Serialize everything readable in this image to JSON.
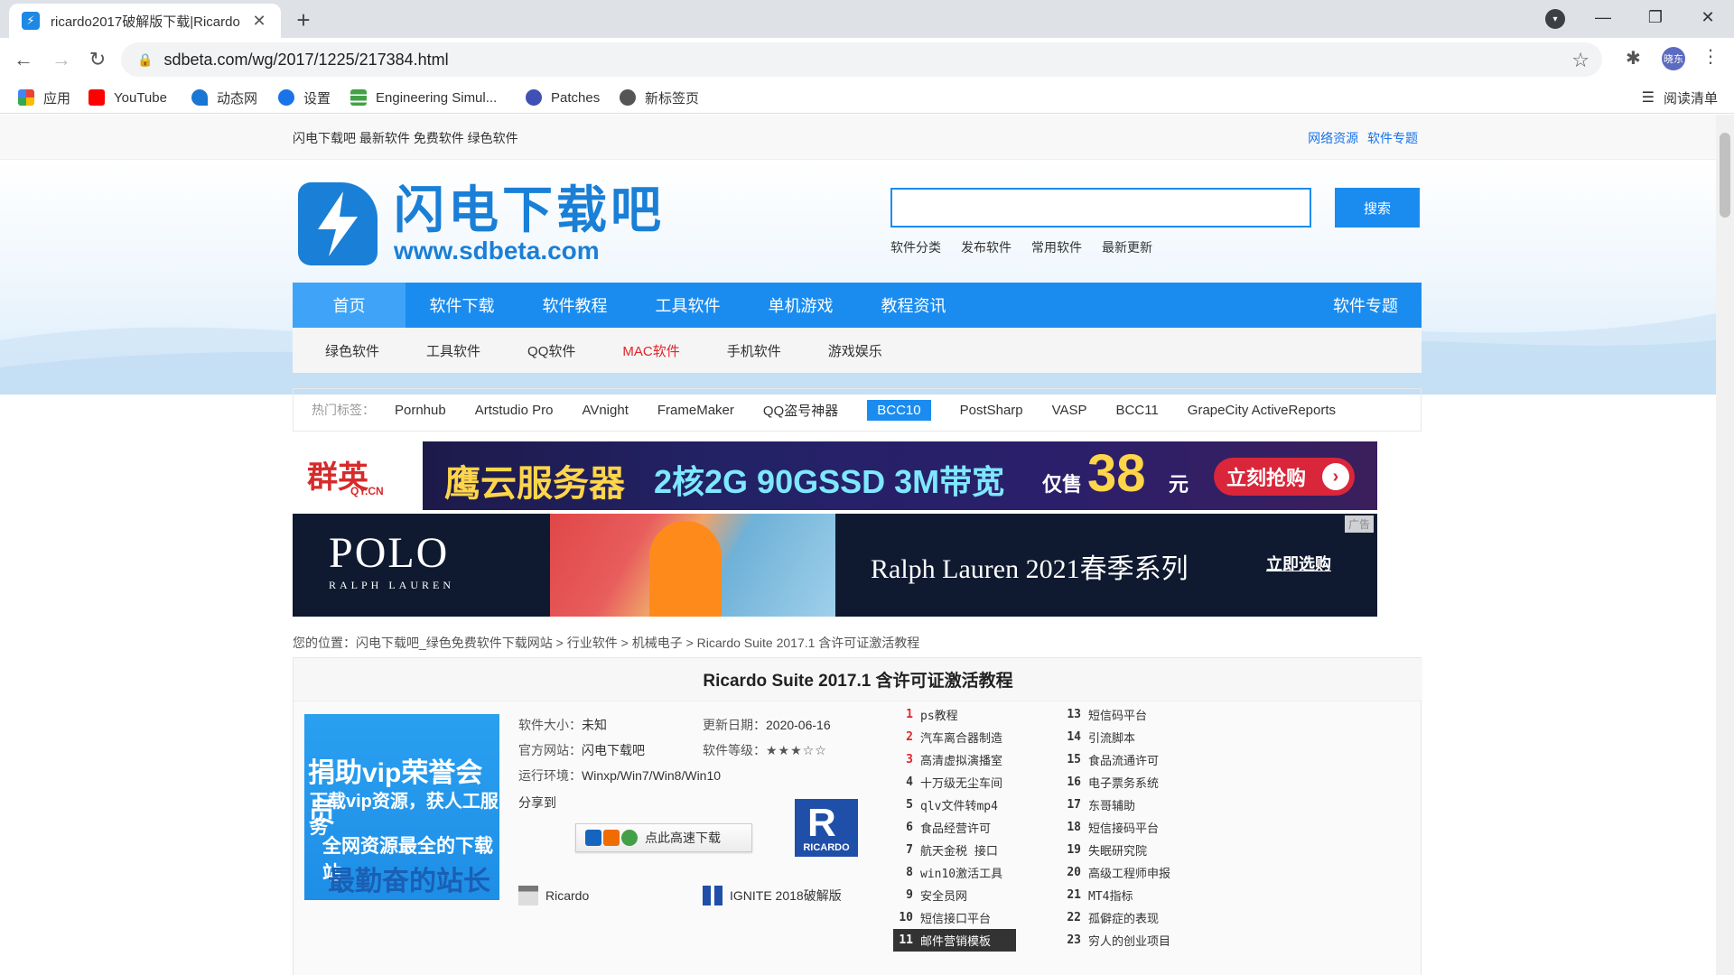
{
  "browser": {
    "tab_title": "ricardo2017破解版下载|Ricardo",
    "url": "sdbeta.com/wg/2017/1225/217384.html",
    "profile_initials": "晓东",
    "bookmarks": [
      {
        "label": "应用",
        "icon": "apps-grid-icon",
        "color": "#ea4335"
      },
      {
        "label": "YouTube",
        "icon": "youtube-icon",
        "color": "#ff0000"
      },
      {
        "label": "动态网",
        "icon": "dongtai-icon",
        "color": "#1976d2"
      },
      {
        "label": "设置",
        "icon": "gear-icon",
        "color": "#1a73e8"
      },
      {
        "label": "Engineering Simul...",
        "icon": "engineering-icon",
        "color": "#43a047"
      },
      {
        "label": "Patches",
        "icon": "patches-icon",
        "color": "#3f51b5"
      },
      {
        "label": "新标签页",
        "icon": "globe-icon",
        "color": "#555555"
      }
    ],
    "reading_list": "阅读清单"
  },
  "site": {
    "top_left": "闪电下载吧 最新软件 免费软件 绿色软件",
    "top_right": [
      "网络资源",
      "软件专题"
    ],
    "logo_cn": "闪电下载吧",
    "logo_en": "www.sdbeta.com",
    "search_button": "搜索",
    "quick_links": [
      "软件分类",
      "发布软件",
      "常用软件",
      "最新更新"
    ],
    "main_nav": [
      "首页",
      "软件下载",
      "软件教程",
      "工具软件",
      "单机游戏",
      "教程资讯"
    ],
    "main_nav_right": "软件专题",
    "sub_nav": [
      {
        "label": "绿色软件",
        "hot": false
      },
      {
        "label": "工具软件",
        "hot": false
      },
      {
        "label": "QQ软件",
        "hot": false
      },
      {
        "label": "MAC软件",
        "hot": true
      },
      {
        "label": "手机软件",
        "hot": false
      },
      {
        "label": "游戏娱乐",
        "hot": false
      }
    ],
    "hot_tags_label": "热门标签：",
    "hot_tags": [
      "Pornhub",
      "Artstudio Pro",
      "AVnight",
      "FrameMaker",
      "QQ盗号神器",
      "BCC10",
      "PostSharp",
      "VASP",
      "BCC11",
      "GrapeCity ActiveReports"
    ],
    "selected_tag": "BCC10"
  },
  "ads": {
    "ad1_brand": "群英",
    "ad1_brand_sub": "QY.CN",
    "ad1_headline": "鹰云服务器",
    "ad1_spec": "2核2G 90GSSD 3M带宽",
    "ad1_only": "仅售",
    "ad1_price": "38",
    "ad1_unit": "元",
    "ad1_cta": "立刻抢购",
    "ad2_brand": "POLO",
    "ad2_brand_sub": "RALPH LAUREN",
    "ad2_slogan": "Ralph Lauren 2021春季系列",
    "ad2_cta": "立即选购",
    "ad2_tag": "广告"
  },
  "breadcrumb": {
    "prefix": "您的位置：",
    "path": "闪电下载吧_绿色免费软件下载网站 > 行业软件 > 机械电子 > Ricardo Suite 2017.1 含许可证激活教程"
  },
  "article": {
    "title": "Ricardo Suite 2017.1 含许可证激活教程",
    "vip_line1": "捐助vip荣誉会员",
    "vip_line2": "下载vip资源，获人工服务",
    "vip_line3": "全网资源最全的下载站",
    "vip_line4": "最勤奋的站长",
    "size_label": "软件大小：",
    "size_value": "未知",
    "update_label": "更新日期：",
    "update_value": "2020-06-16",
    "site_label": "官方网站：",
    "site_value": "闪电下载吧",
    "level_label": "软件等级：",
    "level_value": "★★★☆☆",
    "env_label": "运行环境：",
    "env_value": "Winxp/Win7/Win8/Win10",
    "share_label": "分享到",
    "download_button": "点此高速下载",
    "logo_caption": "RICARDO",
    "related_1": "Ricardo",
    "related_2": "IGNITE 2018破解版"
  },
  "ranking_left": [
    {
      "num": "1",
      "text": "ps教程"
    },
    {
      "num": "2",
      "text": "汽车离合器制造"
    },
    {
      "num": "3",
      "text": "高清虚拟演播室"
    },
    {
      "num": "4",
      "text": "十万级无尘车间"
    },
    {
      "num": "5",
      "text": "qlv文件转mp4"
    },
    {
      "num": "6",
      "text": "食品经营许可"
    },
    {
      "num": "7",
      "text": "航天金税 接口"
    },
    {
      "num": "8",
      "text": "win10激活工具"
    },
    {
      "num": "9",
      "text": "安全员网"
    },
    {
      "num": "10",
      "text": "短信接口平台"
    },
    {
      "num": "11",
      "text": "邮件营销模板"
    }
  ],
  "ranking_right": [
    {
      "num": "13",
      "text": "短信码平台"
    },
    {
      "num": "14",
      "text": "引流脚本"
    },
    {
      "num": "15",
      "text": "食品流通许可"
    },
    {
      "num": "16",
      "text": "电子票务系统"
    },
    {
      "num": "17",
      "text": "东哥辅助"
    },
    {
      "num": "18",
      "text": "短信接码平台"
    },
    {
      "num": "19",
      "text": "失眠研究院"
    },
    {
      "num": "20",
      "text": "高级工程师申报"
    },
    {
      "num": "21",
      "text": "MT4指标"
    },
    {
      "num": "22",
      "text": "孤僻症的表现"
    },
    {
      "num": "23",
      "text": "穷人的创业项目"
    }
  ]
}
